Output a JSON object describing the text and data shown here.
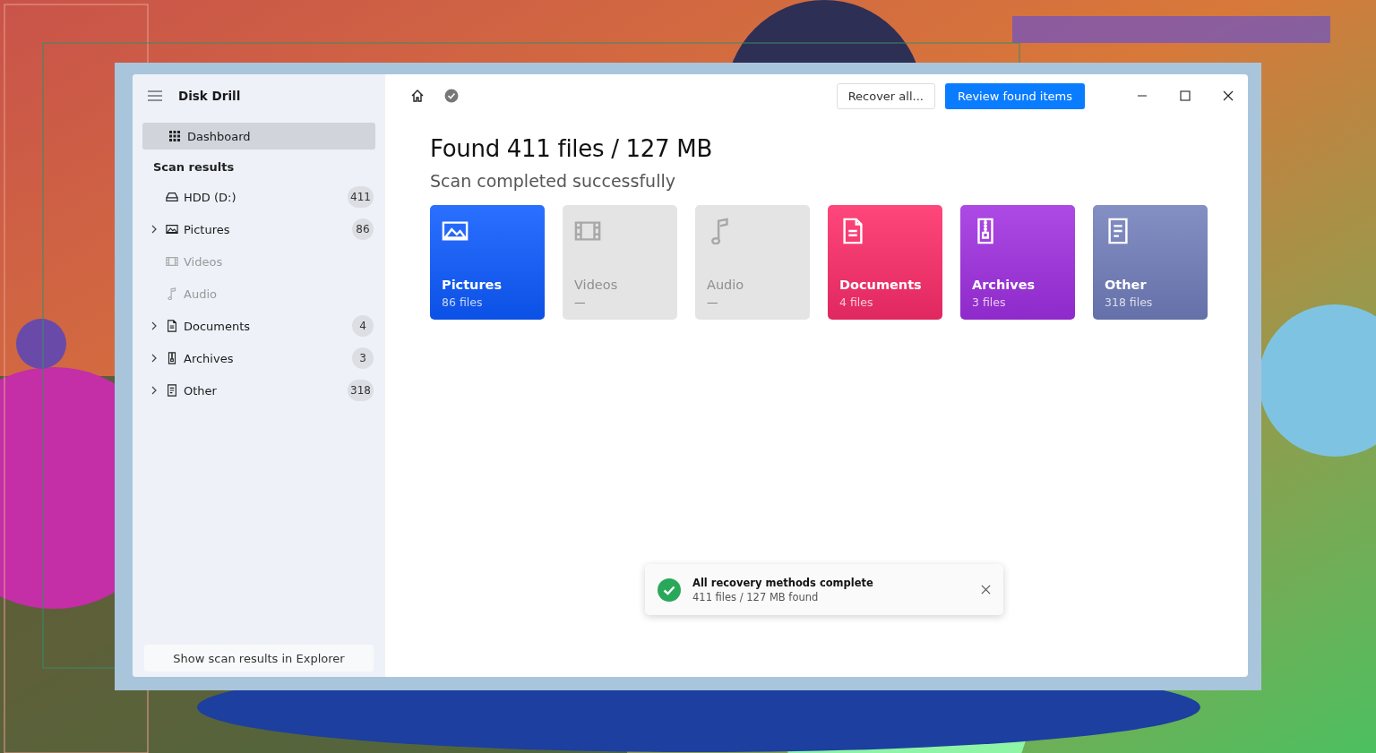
{
  "app": {
    "title": "Disk Drill"
  },
  "sidebar": {
    "dashboard": {
      "label": "Dashboard",
      "selected": true
    },
    "section_title": "Scan results",
    "items": [
      {
        "kind": "drive",
        "label": "HDD (D:)",
        "count": "411",
        "expandable": false,
        "disabled": false,
        "selected": false
      },
      {
        "kind": "pictures",
        "label": "Pictures",
        "count": "86",
        "expandable": true,
        "disabled": false,
        "selected": false
      },
      {
        "kind": "videos",
        "label": "Videos",
        "expandable": false,
        "disabled": true,
        "selected": false
      },
      {
        "kind": "audio",
        "label": "Audio",
        "expandable": false,
        "disabled": true,
        "selected": false
      },
      {
        "kind": "documents",
        "label": "Documents",
        "count": "4",
        "expandable": true,
        "disabled": false,
        "selected": false
      },
      {
        "kind": "archives",
        "label": "Archives",
        "count": "3",
        "expandable": true,
        "disabled": false,
        "selected": false
      },
      {
        "kind": "other",
        "label": "Other",
        "count": "318",
        "expandable": true,
        "disabled": false,
        "selected": false
      }
    ],
    "footer_button": "Show scan results in Explorer"
  },
  "toolbar": {
    "recover_button": "Recover all...",
    "review_button": "Review found items"
  },
  "heading": "Found 411 files / 127 MB",
  "subheading": "Scan completed successfully",
  "cards": [
    {
      "kind": "pictures",
      "label": "Pictures",
      "count": "86 files",
      "disabled": false,
      "color": "#0d5cff"
    },
    {
      "kind": "videos",
      "label": "Videos",
      "count": "—",
      "disabled": true,
      "color": "#e4e4e4"
    },
    {
      "kind": "audio",
      "label": "Audio",
      "count": "—",
      "disabled": true,
      "color": "#e4e4e4"
    },
    {
      "kind": "documents",
      "label": "Documents",
      "count": "4 files",
      "disabled": false,
      "color": "#ff2d68"
    },
    {
      "kind": "archives",
      "label": "Archives",
      "count": "3 files",
      "disabled": false,
      "color": "#a230e0"
    },
    {
      "kind": "other",
      "label": "Other",
      "count": "318 files",
      "disabled": false,
      "color": "#7380bb"
    }
  ],
  "toast": {
    "title": "All recovery methods complete",
    "message": "411 files / 127 MB found"
  }
}
